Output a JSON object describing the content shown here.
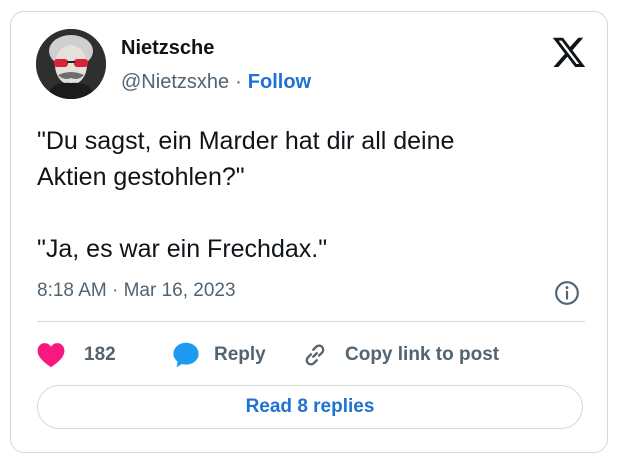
{
  "author": {
    "name": "Nietzsche",
    "handle": "@Nietzsxhe",
    "separator": "·",
    "follow_label": "Follow"
  },
  "tweet": {
    "line1": "\"Du sagst, ein Marder hat dir all deine",
    "line2": "Aktien gestohlen?\"",
    "line3": "\"Ja, es war ein Frechdax.\"",
    "timestamp": "8:18 AM · Mar 16, 2023"
  },
  "actions": {
    "like_count": "182",
    "reply_label": "Reply",
    "copy_link_label": "Copy link to post"
  },
  "footer": {
    "read_replies_label": "Read 8 replies"
  },
  "colors": {
    "like": "#f91880",
    "reply": "#1d9bf0",
    "link": "#1d72d3",
    "muted": "#536471"
  },
  "icons": {
    "logo": "x-logo-icon",
    "info": "info-icon",
    "like": "heart-icon",
    "reply": "speech-bubble-icon",
    "copy": "link-icon"
  }
}
